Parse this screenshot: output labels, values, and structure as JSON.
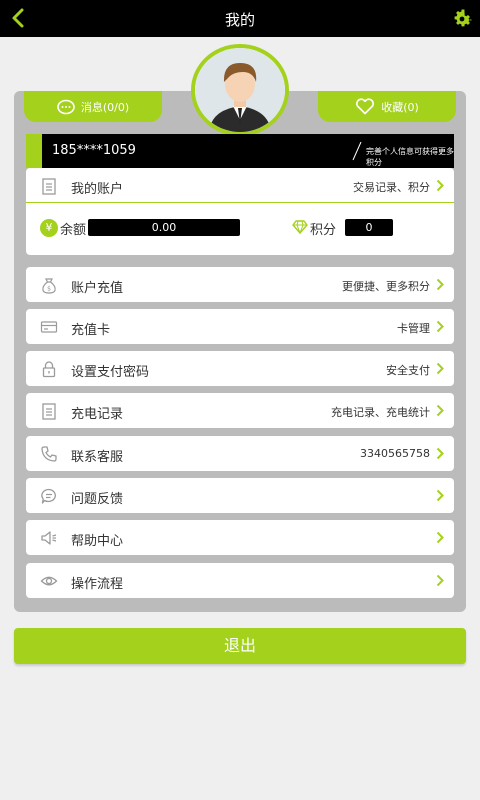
{
  "header": {
    "title": "我的",
    "back_icon": "chevron-left-icon",
    "settings_icon": "gear-icon"
  },
  "tabs": {
    "messages": {
      "label": "消息(0/0)",
      "icon": "chat-bubble-icon"
    },
    "favorites": {
      "label": "收藏(0)",
      "icon": "heart-icon"
    }
  },
  "user": {
    "phone": "185****1059",
    "hint": "完善个人信息可获得更多积分"
  },
  "account": {
    "label": "我的账户",
    "right": "交易记录、积分",
    "balance_label": "余额",
    "balance_value": "0.00",
    "points_label": "积分",
    "points_value": "0"
  },
  "menu": [
    {
      "label": "账户充值",
      "right": "更便捷、更多积分",
      "icon": "money-bag-icon"
    },
    {
      "label": "充值卡",
      "right": "卡管理",
      "icon": "card-icon"
    },
    {
      "label": "设置支付密码",
      "right": "安全支付",
      "icon": "lock-icon"
    },
    {
      "label": "充电记录",
      "right": "充电记录、充电统计",
      "icon": "clipboard-icon"
    },
    {
      "label": "联系客服",
      "right": "3340565758",
      "icon": "phone-icon"
    },
    {
      "label": "问题反馈",
      "right": "",
      "icon": "chat-icon"
    },
    {
      "label": "帮助中心",
      "right": "",
      "icon": "speaker-icon"
    },
    {
      "label": "操作流程",
      "right": "",
      "icon": "eye-icon"
    }
  ],
  "logout_label": "退出",
  "colors": {
    "accent": "#a3d11c",
    "topbar": "#000000",
    "panel": "#bbbbbb",
    "background": "#efefef"
  }
}
